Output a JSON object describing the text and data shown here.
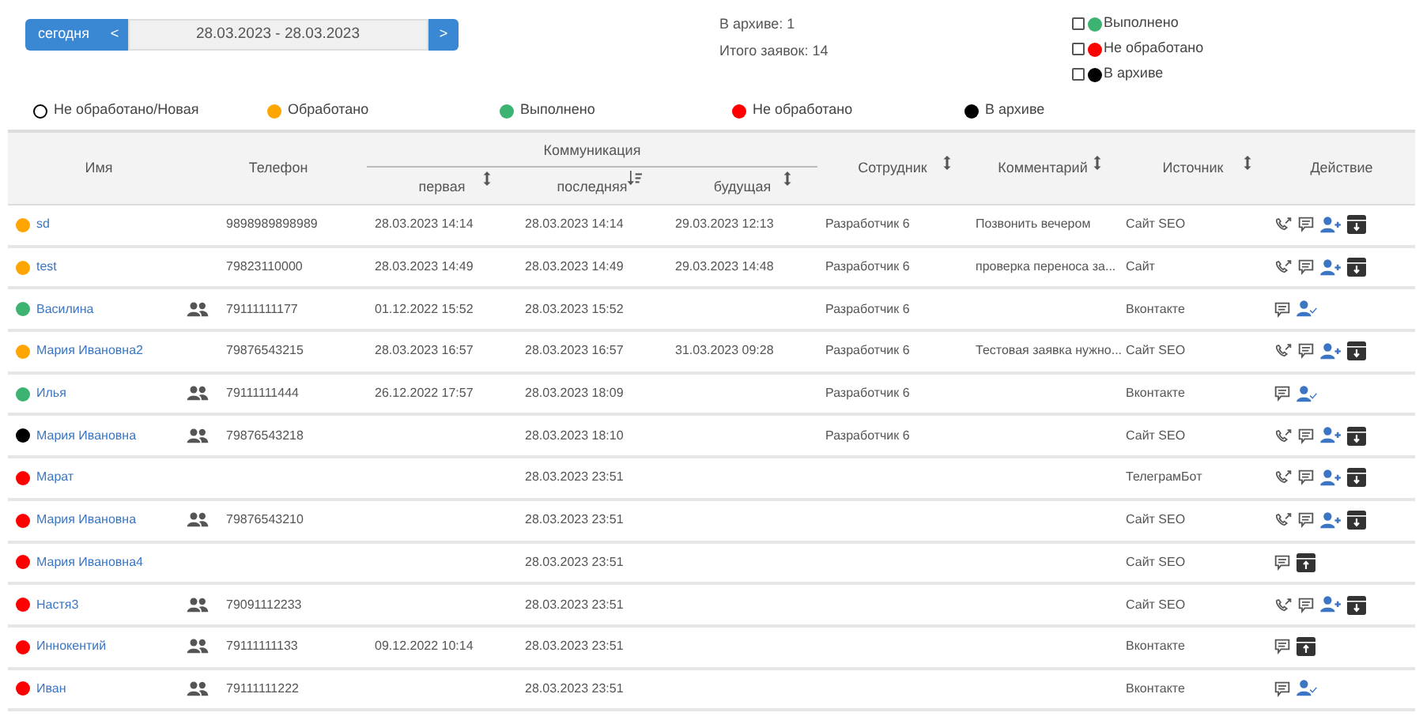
{
  "date_bar": {
    "today_button": "сегодня",
    "prev_button": "<",
    "range": "28.03.2023 - 28.03.2023",
    "next_button": ">"
  },
  "stats": [
    "В архиве: 1",
    "Итого заявок: 14"
  ],
  "filters": [
    {
      "label": "Выполнено",
      "color": "#3cb371",
      "checked": false
    },
    {
      "label": "Не обработано",
      "color": "#ff0000",
      "checked": false
    },
    {
      "label": "В архиве",
      "color": "#000000",
      "checked": false
    }
  ],
  "legend": [
    {
      "label": "Не обработано/Новая",
      "kind": "ring",
      "color": "#000000"
    },
    {
      "label": "Обработано",
      "kind": "dot",
      "color": "#ffa500"
    },
    {
      "label": "Выполнено",
      "kind": "dot",
      "color": "#3cb371"
    },
    {
      "label": "Не обработано",
      "kind": "dot",
      "color": "#ff0000"
    },
    {
      "label": "В архиве",
      "kind": "dot",
      "color": "#000000"
    }
  ],
  "table": {
    "columns": [
      {
        "label": "Имя"
      },
      {
        "label": "Телефон"
      },
      {
        "label": "Коммуникация",
        "children": [
          {
            "label": "первая",
            "sorted": false
          },
          {
            "label": "последняя",
            "sorted": true
          },
          {
            "label": "будущая",
            "sorted": false
          }
        ]
      },
      {
        "label": "Сотрудник",
        "sorted": false
      },
      {
        "label": "Комментарий",
        "sorted": false
      },
      {
        "label": "Источник",
        "sorted": false
      },
      {
        "label": "Действие"
      }
    ],
    "rows": [
      {
        "color": "#ffa500",
        "name": "sd",
        "group": false,
        "phone": "9898989898989",
        "first": "28.03.2023 14:14",
        "last": "28.03.2023 14:14",
        "future": "29.03.2023 12:13",
        "employee": "Разработчик 6",
        "comment": "Позвонить вечером",
        "source": "Сайт SEO",
        "actions": [
          {
            "kind": "call"
          },
          {
            "kind": "comment"
          },
          {
            "kind": "assign"
          },
          {
            "kind": "archive"
          }
        ]
      },
      {
        "color": "#ffa500",
        "name": "test",
        "group": false,
        "phone": "79823110000",
        "first": "28.03.2023 14:49",
        "last": "28.03.2023 14:49",
        "future": "29.03.2023 14:48",
        "employee": "Разработчик 6",
        "comment": "проверка переноса за...",
        "source": "Сайт",
        "actions": [
          {
            "kind": "call"
          },
          {
            "kind": "comment"
          },
          {
            "kind": "assign"
          },
          {
            "kind": "archive"
          }
        ]
      },
      {
        "color": "#3cb371",
        "name": "Василина",
        "group": true,
        "phone": "79111111177",
        "first": "01.12.2022 15:52",
        "last": "28.03.2023 15:52",
        "employee": "Разработчик 6",
        "source": "Вконтакте",
        "actions": [
          {
            "kind": "comment"
          },
          {
            "kind": "assigned"
          }
        ]
      },
      {
        "color": "#ffa500",
        "name": "Мария Ивановна2",
        "group": false,
        "phone": "79876543215",
        "first": "28.03.2023 16:57",
        "last": "28.03.2023 16:57",
        "future": "31.03.2023 09:28",
        "employee": "Разработчик 6",
        "comment": "Тестовая заявка нужно...",
        "source": "Сайт SEO",
        "actions": [
          {
            "kind": "call"
          },
          {
            "kind": "comment"
          },
          {
            "kind": "assign"
          },
          {
            "kind": "archive"
          }
        ]
      },
      {
        "color": "#3cb371",
        "name": "Илья",
        "group": true,
        "phone": "79111111444",
        "first": "26.12.2022 17:57",
        "last": "28.03.2023 18:09",
        "employee": "Разработчик 6",
        "source": "Вконтакте",
        "actions": [
          {
            "kind": "comment"
          },
          {
            "kind": "assigned"
          }
        ]
      },
      {
        "color": "#000000",
        "name": "Мария Ивановна",
        "group": true,
        "phone": "79876543218",
        "last": "28.03.2023 18:10",
        "employee": "Разработчик 6",
        "source": "Сайт SEO",
        "actions": [
          {
            "kind": "call"
          },
          {
            "kind": "comment"
          },
          {
            "kind": "assign"
          },
          {
            "kind": "archive"
          }
        ]
      },
      {
        "color": "#ff0000",
        "name": "Марат",
        "group": false,
        "last": "28.03.2023 23:51",
        "source": "ТелеграмБот",
        "actions": [
          {
            "kind": "call"
          },
          {
            "kind": "comment"
          },
          {
            "kind": "assign"
          },
          {
            "kind": "archive"
          }
        ]
      },
      {
        "color": "#ff0000",
        "name": "Мария Ивановна",
        "group": true,
        "phone": "79876543210",
        "last": "28.03.2023 23:51",
        "source": "Сайт SEO",
        "actions": [
          {
            "kind": "call"
          },
          {
            "kind": "comment"
          },
          {
            "kind": "assign"
          },
          {
            "kind": "archive"
          }
        ]
      },
      {
        "color": "#ff0000",
        "name": "Мария Ивановна4",
        "group": false,
        "last": "28.03.2023 23:51",
        "source": "Сайт SEO",
        "actions": [
          {
            "kind": "comment"
          },
          {
            "kind": "unarchive"
          }
        ]
      },
      {
        "color": "#ff0000",
        "name": "Настя3",
        "group": true,
        "phone": "79091112233",
        "last": "28.03.2023 23:51",
        "source": "Сайт SEO",
        "actions": [
          {
            "kind": "call"
          },
          {
            "kind": "comment"
          },
          {
            "kind": "assign"
          },
          {
            "kind": "archive"
          }
        ]
      },
      {
        "color": "#ff0000",
        "name": "Иннокентий",
        "group": true,
        "phone": "79111111133",
        "first": "09.12.2022 10:14",
        "last": "28.03.2023 23:51",
        "source": "Вконтакте",
        "actions": [
          {
            "kind": "comment"
          },
          {
            "kind": "unarchive"
          }
        ]
      },
      {
        "color": "#ff0000",
        "name": "Иван",
        "group": true,
        "phone": "79111111222",
        "last": "28.03.2023 23:51",
        "source": "Вконтакте",
        "actions": [
          {
            "kind": "comment"
          },
          {
            "kind": "assigned"
          }
        ]
      }
    ]
  }
}
